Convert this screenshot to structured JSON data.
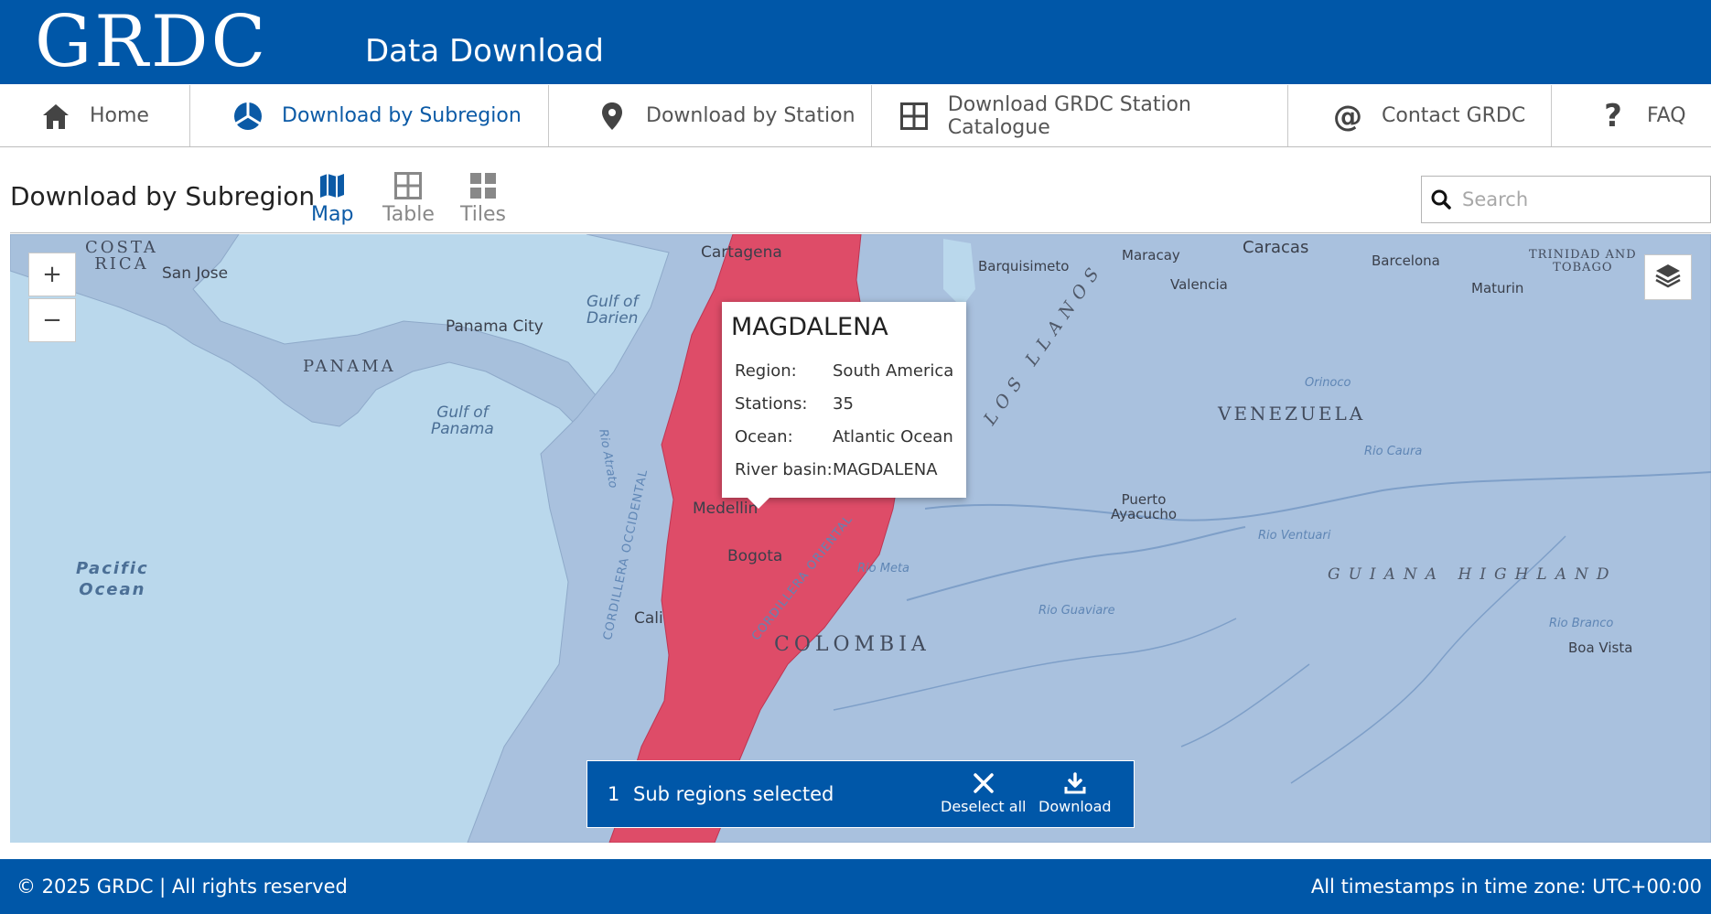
{
  "header": {
    "logo": "GRDC",
    "title": "Data Download"
  },
  "nav": {
    "items": [
      {
        "label": "Home",
        "icon": "home-icon",
        "active": false
      },
      {
        "label": "Download by Subregion",
        "icon": "subregion-icon",
        "active": true
      },
      {
        "label": "Download by Station",
        "icon": "map-pin-icon",
        "active": false
      },
      {
        "label": "Download GRDC Station Catalogue",
        "icon": "grid-icon",
        "active": false
      },
      {
        "label": "Contact GRDC",
        "icon": "at-icon",
        "active": false
      },
      {
        "label": "FAQ",
        "icon": "question-icon",
        "active": false
      }
    ]
  },
  "subheader": {
    "title": "Download by Subregion",
    "views": [
      {
        "label": "Map",
        "icon": "map-icon",
        "active": true
      },
      {
        "label": "Table",
        "icon": "table-icon",
        "active": false
      },
      {
        "label": "Tiles",
        "icon": "tiles-icon",
        "active": false
      }
    ],
    "search": {
      "placeholder": "Search",
      "value": ""
    }
  },
  "map": {
    "zoom_in": "+",
    "zoom_out": "−",
    "labels": {
      "costa_rica": "COSTA\nRICA",
      "san_jose": "San Jose",
      "panama": "PANAMA",
      "panama_city": "Panama City",
      "gulf_of_darien": "Gulf of\nDarien",
      "gulf_of_panama": "Gulf of\nPanama",
      "pacific_ocean": "Pacific\nOcean",
      "cartagena": "Cartagena",
      "medellin": "Medellin",
      "bogota": "Bogota",
      "cali": "Cali",
      "colombia": "COLOMBIA",
      "caracas": "Caracas",
      "maracay": "Maracay",
      "valencia": "Valencia",
      "barquisimeto": "Barquisimeto",
      "barcelona": "Barcelona",
      "maturin": "Maturin",
      "trinidad": "TRINIDAD AND\nTOBAGO",
      "venezuela": "VENEZUELA",
      "los_llanos": "LOS LLANOS",
      "puerto_ayacucho": "Puerto\nAyacucho",
      "guiana_highlands": "GUIANA HIGHLAND",
      "boa_vista": "Boa Vista",
      "rio_meta": "Rio Meta",
      "rio_guaviare": "Rio Guaviare",
      "rio_ventuari": "Rio Ventuari",
      "orinoco": "Orinoco",
      "rio_caura": "Rio Caura",
      "rio_branco": "Rio Branco",
      "rio_atrato": "Rio Atrato",
      "cordillera_occidental": "CORDILLERA OCCIDENTAL",
      "cordillera_oriental": "CORDILLERA ORIENTAL"
    },
    "highlight_color": "#e3435f"
  },
  "popup": {
    "title": "MAGDALENA",
    "rows": [
      {
        "key": "Region:",
        "value": "South America"
      },
      {
        "key": "Stations:",
        "value": "35"
      },
      {
        "key": "Ocean:",
        "value": "Atlantic Ocean"
      },
      {
        "key": "River basin:",
        "value": "MAGDALENA"
      }
    ]
  },
  "selection_bar": {
    "count": "1",
    "label": "Sub regions selected",
    "deselect_label": "Deselect all",
    "download_label": "Download"
  },
  "footer": {
    "copyright": "© 2025 GRDC | All rights reserved",
    "timezone": "All timestamps in time zone: UTC+00:00"
  },
  "colors": {
    "brand_blue": "#0057a8",
    "active_link": "#0b5aa6",
    "land": "#a9c1de",
    "water": "#b8d6ea",
    "selected_region": "#e3435f"
  }
}
